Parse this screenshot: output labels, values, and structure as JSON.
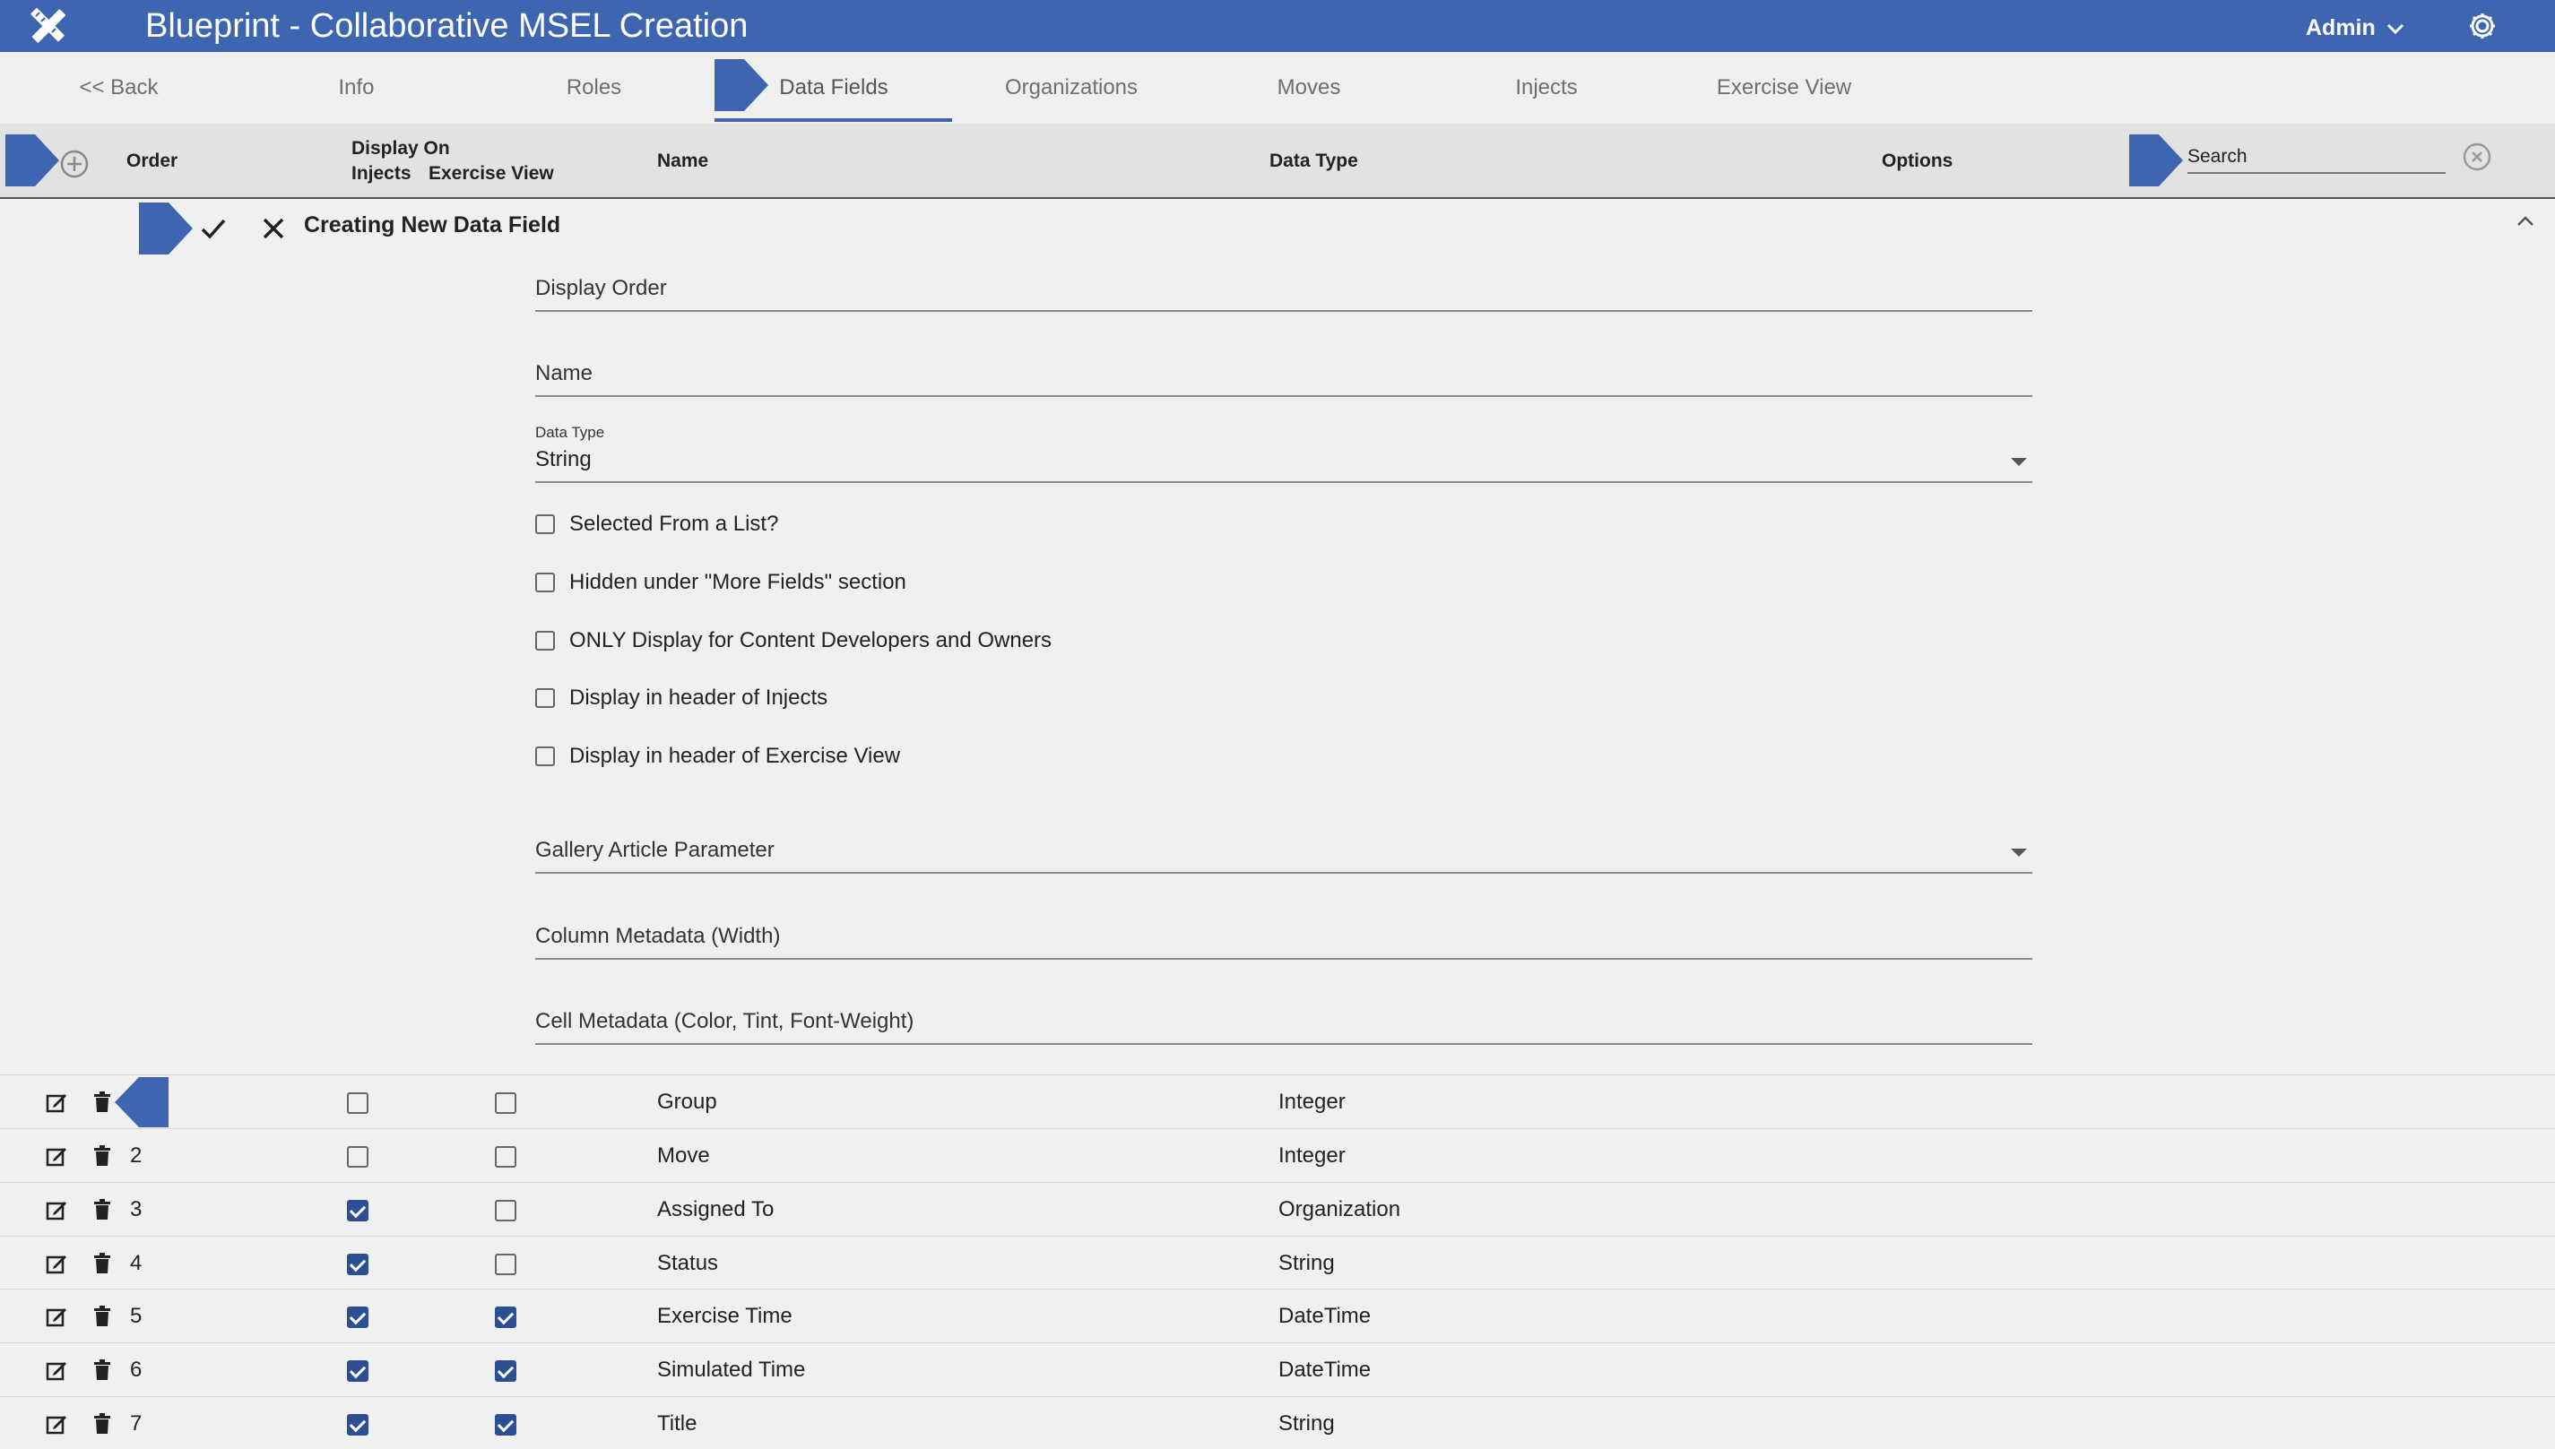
{
  "app": {
    "title": "Blueprint - Collaborative MSEL Creation",
    "user": "Admin",
    "accent_color": "#3d65b0",
    "icons": {
      "logo": "pencil-ruler-icon",
      "user_menu": "chevron-down-icon",
      "settings": "gear-icon"
    }
  },
  "tabs": [
    {
      "label": "<< Back"
    },
    {
      "label": "Info"
    },
    {
      "label": "Roles"
    },
    {
      "label": "Data Fields",
      "active": true
    },
    {
      "label": "Organizations"
    },
    {
      "label": "Moves"
    },
    {
      "label": "Injects"
    },
    {
      "label": "Exercise View"
    }
  ],
  "table_header": {
    "order": "Order",
    "display_on": "Display On",
    "injects": "Injects",
    "exercise_view": "Exercise View",
    "name": "Name",
    "data_type": "Data Type",
    "options": "Options",
    "search_placeholder": "Search",
    "icons": {
      "add": "add-circle-icon",
      "clear": "clear-circle-icon"
    }
  },
  "new_field_form": {
    "title": "Creating New Data Field",
    "icons": {
      "save": "check-icon",
      "cancel": "close-icon",
      "collapse": "chevron-up-icon"
    },
    "display_order": {
      "label": "Display Order",
      "value": ""
    },
    "name": {
      "label": "Name",
      "value": ""
    },
    "data_type": {
      "label": "Data Type",
      "value": "String"
    },
    "checkboxes": [
      {
        "label": "Selected From a List?",
        "checked": false
      },
      {
        "label": "Hidden under \"More Fields\" section",
        "checked": false
      },
      {
        "label": "ONLY Display for Content Developers and Owners",
        "checked": false
      },
      {
        "label": "Display in header of Injects",
        "checked": false
      },
      {
        "label": "Display in header of Exercise View",
        "checked": false
      }
    ],
    "gallery_article_parameter": {
      "label": "Gallery Article Parameter",
      "value": ""
    },
    "column_metadata": {
      "label": "Column Metadata (Width)",
      "value": ""
    },
    "cell_metadata": {
      "label": "Cell Metadata (Color, Tint, Font-Weight)",
      "value": ""
    }
  },
  "rows": [
    {
      "order": "",
      "injects": false,
      "exercise_view": false,
      "name": "Group",
      "data_type": "Integer"
    },
    {
      "order": "2",
      "injects": false,
      "exercise_view": false,
      "name": "Move",
      "data_type": "Integer"
    },
    {
      "order": "3",
      "injects": true,
      "exercise_view": false,
      "name": "Assigned To",
      "data_type": "Organization"
    },
    {
      "order": "4",
      "injects": true,
      "exercise_view": false,
      "name": "Status",
      "data_type": "String"
    },
    {
      "order": "5",
      "injects": true,
      "exercise_view": true,
      "name": "Exercise Time",
      "data_type": "DateTime"
    },
    {
      "order": "6",
      "injects": true,
      "exercise_view": true,
      "name": "Simulated Time",
      "data_type": "DateTime"
    },
    {
      "order": "7",
      "injects": true,
      "exercise_view": true,
      "name": "Title",
      "data_type": "String"
    }
  ]
}
